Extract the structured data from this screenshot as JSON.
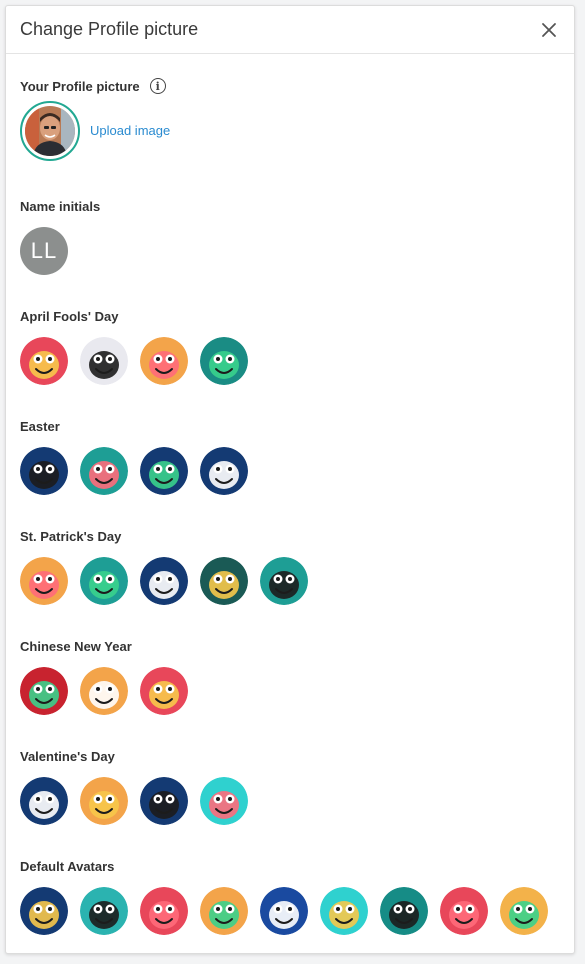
{
  "modal": {
    "title": "Change Profile picture",
    "close_icon": "close-icon"
  },
  "profile": {
    "title": "Your Profile picture",
    "info_icon": "info-icon",
    "upload_label": "Upload image",
    "accent_color": "#22a892",
    "link_color": "#2a8bd0"
  },
  "initials": {
    "title": "Name initials",
    "text": "LL",
    "bg_color": "#8c8f8e"
  },
  "sections": [
    {
      "title": "April Fools' Day",
      "avatars": [
        {
          "name": "whale-avatar",
          "bg": "#e8475a"
        },
        {
          "name": "bird-avatar",
          "bg": "#e9e9ef"
        },
        {
          "name": "clown-avatar",
          "bg": "#f3a44a"
        },
        {
          "name": "glasses-mustache-avatar",
          "bg": "#1a8c84"
        }
      ]
    },
    {
      "title": "Easter",
      "avatars": [
        {
          "name": "bunny-avatar",
          "bg": "#143a73"
        },
        {
          "name": "rooster-avatar",
          "bg": "#1e9e95"
        },
        {
          "name": "chick-avatar",
          "bg": "#143a73"
        },
        {
          "name": "egg-avatar",
          "bg": "#143a73"
        }
      ]
    },
    {
      "title": "St. Patrick's Day",
      "avatars": [
        {
          "name": "leprechaun-hat-avatar",
          "bg": "#f3a44a"
        },
        {
          "name": "clover-avatar",
          "bg": "#1e9e95"
        },
        {
          "name": "shamrock-avatar",
          "bg": "#143a73"
        },
        {
          "name": "pot-of-gold-avatar",
          "bg": "#1a5a55"
        },
        {
          "name": "leprechaun-avatar",
          "bg": "#1e9e95"
        }
      ]
    },
    {
      "title": "Chinese New Year",
      "avatars": [
        {
          "name": "dragon-avatar",
          "bg": "#c8232f"
        },
        {
          "name": "lantern-monster-avatar",
          "bg": "#f3a44a"
        },
        {
          "name": "spiral-avatar",
          "bg": "#e8475a"
        }
      ]
    },
    {
      "title": "Valentine's Day",
      "avatars": [
        {
          "name": "heart-eyes-blue-avatar",
          "bg": "#143a73"
        },
        {
          "name": "heart-eyes-orange-avatar",
          "bg": "#f3a44a"
        },
        {
          "name": "heart-monster-avatar",
          "bg": "#143a73"
        },
        {
          "name": "heart-tongue-avatar",
          "bg": "#2fd1cf"
        }
      ]
    },
    {
      "title": "Default Avatars",
      "avatars": [
        {
          "name": "monster-blue-fangs-avatar",
          "bg": "#143a73"
        },
        {
          "name": "monster-teal-cyclops-avatar",
          "bg": "#2bb3b0"
        },
        {
          "name": "monster-red-grin-avatar",
          "bg": "#e8475a"
        },
        {
          "name": "monster-orange-cyclops-avatar",
          "bg": "#f3a44a"
        },
        {
          "name": "monster-navy-avatar",
          "bg": "#1a4aa0"
        },
        {
          "name": "monster-aqua-avatar",
          "bg": "#2fd1cf"
        },
        {
          "name": "monster-teal-sleepy-avatar",
          "bg": "#168c86"
        },
        {
          "name": "monster-pink-tongue-avatar",
          "bg": "#e8475a"
        },
        {
          "name": "monster-yellow-smile-avatar",
          "bg": "#f3b24a"
        }
      ]
    }
  ]
}
